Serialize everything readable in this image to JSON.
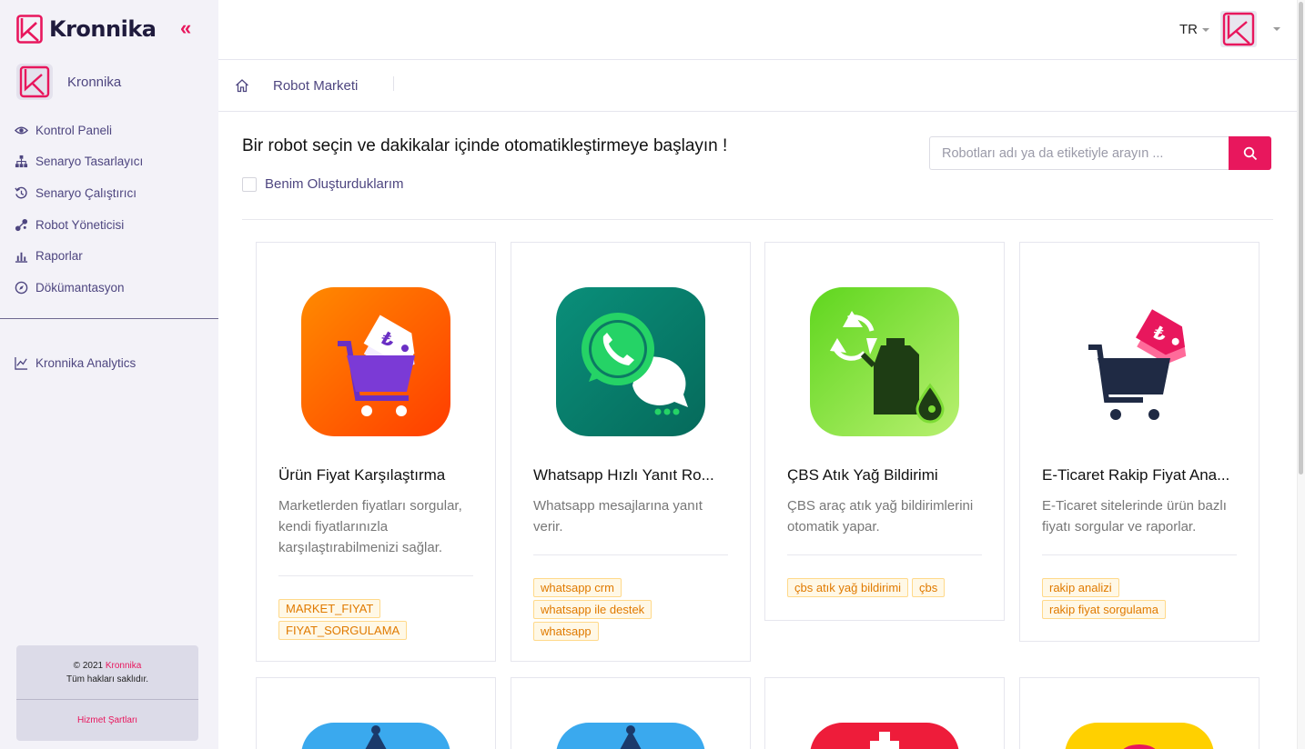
{
  "brand": {
    "name": "Kronnika",
    "logo_icon": "kronnika-logo-icon"
  },
  "sidebar": {
    "user_name": "Kronnika",
    "items": [
      {
        "label": "Kontrol Paneli",
        "icon": "eye-icon"
      },
      {
        "label": "Senaryo Tasarlayıcı",
        "icon": "sitemap-icon"
      },
      {
        "label": "Senaryo Çalıştırıcı",
        "icon": "history-icon"
      },
      {
        "label": "Robot Yöneticisi",
        "icon": "nodes-icon"
      },
      {
        "label": "Raporlar",
        "icon": "bar-chart-icon"
      },
      {
        "label": "Dökümantasyon",
        "icon": "compass-icon"
      }
    ],
    "analytics_label": "Kronnika Analytics",
    "footer": {
      "copyright": "© 2021",
      "brand": "Kronnika",
      "rights": "Tüm hakları saklıdır.",
      "terms": "Hizmet Şartları"
    }
  },
  "header": {
    "language": "TR"
  },
  "breadcrumb": {
    "current": "Robot Marketi"
  },
  "main": {
    "headline": "Bir robot seçin ve dakikalar içinde otomatikleştirmeye başlayın !",
    "checkbox_label": "Benim Oluşturduklarım",
    "search_placeholder": "Robotları adı ya da etiketiyle arayın ..."
  },
  "cards": [
    {
      "title": "Ürün Fiyat Karşılaştırma",
      "description": "Marketlerden fiyatları sorgular, kendi fiyatlarınızla karşılaştırabilmenizi sağlar.",
      "tags": [
        "MARKET_FIYAT",
        "FIYAT_SORGULAMA"
      ],
      "icon": "shopping-cart-price-tag-icon"
    },
    {
      "title": "Whatsapp Hızlı Yanıt Ro...",
      "description": "Whatsapp mesajlarına yanıt verir.",
      "tags": [
        "whatsapp crm",
        "whatsapp ile destek",
        "whatsapp"
      ],
      "icon": "whatsapp-chat-icon"
    },
    {
      "title": "ÇBS Atık Yağ Bildirimi",
      "description": "ÇBS araç atık yağ bildirimlerini otomatik yapar.",
      "tags": [
        "çbs atık yağ bildirimi",
        "çbs"
      ],
      "icon": "recycle-oil-canister-icon"
    },
    {
      "title": "E-Ticaret Rakip Fiyat Ana...",
      "description": "E-Ticaret sitelerinde ürün bazlı fiyatı sorgular ve raporlar.",
      "tags": [
        "rakip analizi",
        "rakip fiyat sorgulama"
      ],
      "icon": "cart-price-tag-icon"
    }
  ],
  "colors": {
    "accent": "#e8175d",
    "nav_text": "#4e4680",
    "sidebar_bg": "#f3f2f8",
    "tag_text": "#e07a00"
  }
}
